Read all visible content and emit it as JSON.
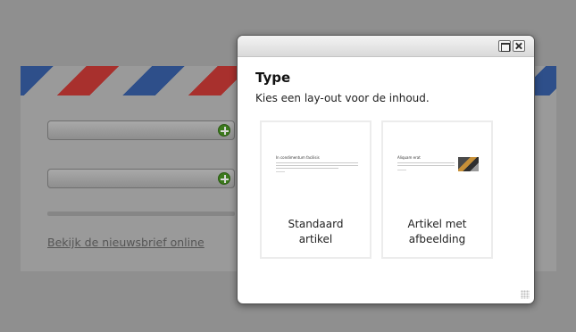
{
  "background": {
    "newsletter_link": "Bekijk de nieuwsbrief online",
    "add_icon": "plus-icon"
  },
  "dialog": {
    "title": "Type",
    "subtitle": "Kies een lay-out voor de inhoud.",
    "titlebar": {
      "maximize_icon": "maximize-icon",
      "close_icon": "close-icon"
    },
    "layouts": [
      {
        "label_line1": "Standaard",
        "label_line2": "artikel",
        "thumb_title": "In condimentum facilisis",
        "has_image": false
      },
      {
        "label_line1": "Artikel met",
        "label_line2": "afbeelding",
        "thumb_title": "Aliquam erat",
        "has_image": true
      }
    ]
  },
  "colors": {
    "stripe_blue": "#2e4f8a",
    "stripe_red": "#a8302d",
    "add_green": "#3c7a1c"
  }
}
